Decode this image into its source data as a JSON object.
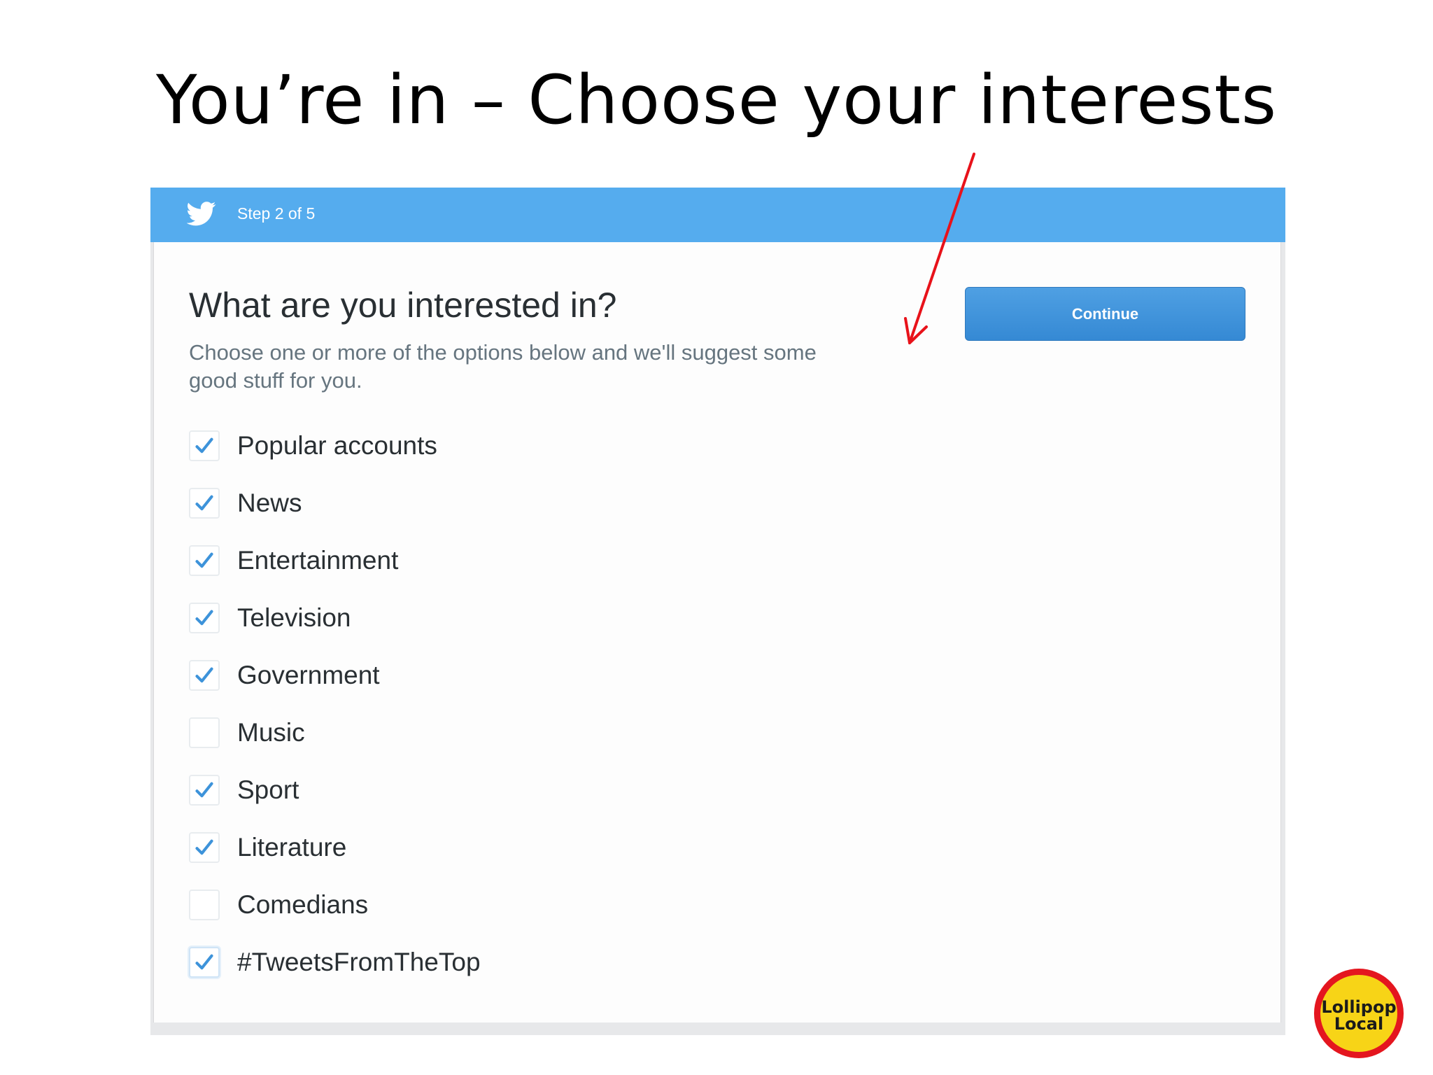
{
  "slide": {
    "title": "You’re in – Choose your interests"
  },
  "header": {
    "step_label": "Step 2 of 5",
    "brand_icon": "twitter-bird-icon",
    "bar_color": "#55acee"
  },
  "main": {
    "heading": "What are you interested in?",
    "subtext": "Choose one or more of the options below and we'll suggest some good stuff for you.",
    "continue_label": "Continue",
    "accent_color": "#3d93da"
  },
  "interests": [
    {
      "label": "Popular accounts",
      "checked": true
    },
    {
      "label": "News",
      "checked": true
    },
    {
      "label": "Entertainment",
      "checked": true
    },
    {
      "label": "Television",
      "checked": true
    },
    {
      "label": "Government",
      "checked": true
    },
    {
      "label": "Music",
      "checked": false
    },
    {
      "label": "Sport",
      "checked": true
    },
    {
      "label": "Literature",
      "checked": true
    },
    {
      "label": "Comedians",
      "checked": false
    },
    {
      "label": "#TweetsFromTheTop",
      "checked": true
    }
  ],
  "annotation": {
    "arrow_color": "#e8121a"
  },
  "logo": {
    "line1": "Lollipop",
    "line2": "Local"
  }
}
